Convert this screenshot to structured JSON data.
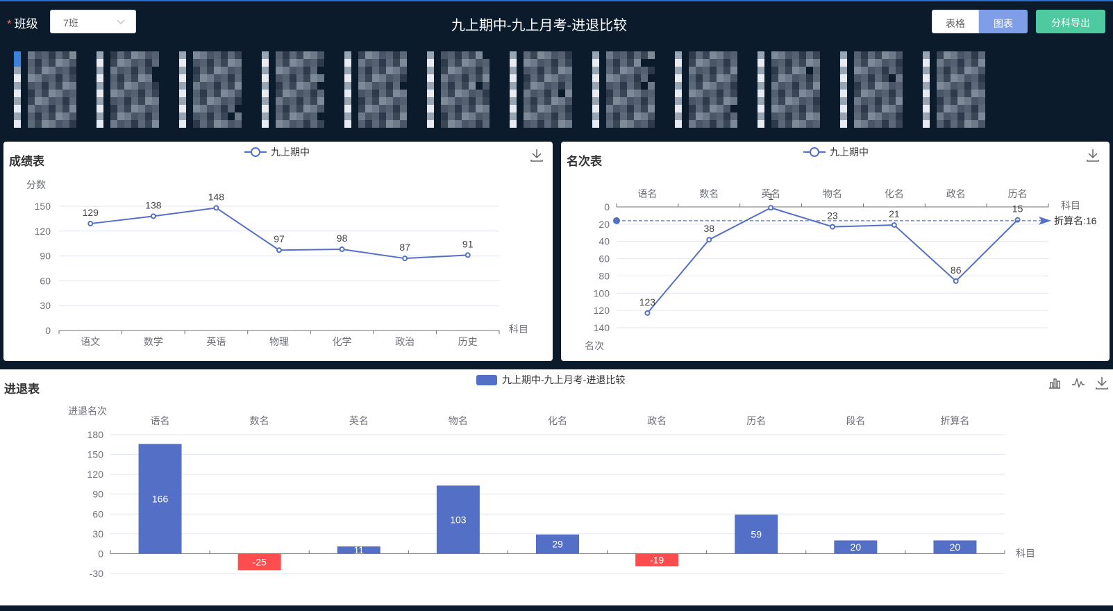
{
  "topbar": {
    "class_label": "班级",
    "required_mark": "*",
    "class_value": "7班",
    "page_title": "九上期中-九上月考-进退比较",
    "table_button": "表格",
    "chart_button": "图表",
    "export_button": "分科导出"
  },
  "colors": {
    "accent": "#5470c6",
    "negative": "#ff4d4f",
    "background": "#0b1b2c",
    "export_green": "#4ec9a0",
    "chart_button_blue": "#7e9ee8"
  },
  "icons": [
    "chevron-down-icon",
    "download-icon",
    "bar-chart-icon",
    "line-chart-icon"
  ],
  "chart_data": [
    {
      "type": "line",
      "panel_title": "成绩表",
      "legend": [
        "九上期中"
      ],
      "ylabel": "分数",
      "xlabel": "科目",
      "categories": [
        "语文",
        "数学",
        "英语",
        "物理",
        "化学",
        "政治",
        "历史"
      ],
      "series": [
        {
          "name": "九上期中",
          "values": [
            129,
            138,
            148,
            97,
            98,
            87,
            91
          ]
        }
      ],
      "ylim": [
        0,
        150
      ],
      "yticks": [
        0,
        30,
        60,
        90,
        120,
        150
      ],
      "grid": true,
      "legend_position": "top-center"
    },
    {
      "type": "line",
      "panel_title": "名次表",
      "legend": [
        "九上期中"
      ],
      "ylabel": "名次",
      "xlabel": "科目",
      "y_inverted": true,
      "x_axis_position": "top",
      "categories": [
        "语名",
        "数名",
        "英名",
        "物名",
        "化名",
        "政名",
        "历名"
      ],
      "series": [
        {
          "name": "九上期中",
          "values": [
            123,
            38,
            1,
            23,
            21,
            86,
            15
          ]
        }
      ],
      "point_labels": [
        "123",
        "38",
        "1",
        "23",
        "21",
        "86",
        "15"
      ],
      "ylim": [
        0,
        140
      ],
      "yticks": [
        0,
        20,
        40,
        60,
        80,
        100,
        120,
        140
      ],
      "mark_line": {
        "label": "折算名:16",
        "value": 16
      },
      "grid": true,
      "legend_position": "top-center"
    },
    {
      "type": "bar",
      "panel_title": "进退表",
      "legend": [
        "九上期中-九上月考-进退比较"
      ],
      "ylabel": "进退名次",
      "xlabel": "科目",
      "x_axis_position": "top",
      "categories": [
        "语名",
        "数名",
        "英名",
        "物名",
        "化名",
        "政名",
        "历名",
        "段名",
        "折算名"
      ],
      "series": [
        {
          "name": "九上期中-九上月考-进退比较",
          "values": [
            166,
            -25,
            11,
            103,
            29,
            -19,
            59,
            20,
            20
          ]
        }
      ],
      "ylim": [
        -30,
        180
      ],
      "yticks": [
        -30,
        0,
        30,
        60,
        90,
        120,
        150,
        180
      ],
      "negative_color": "#ff4d4f",
      "grid": true,
      "legend_position": "top-center"
    }
  ]
}
